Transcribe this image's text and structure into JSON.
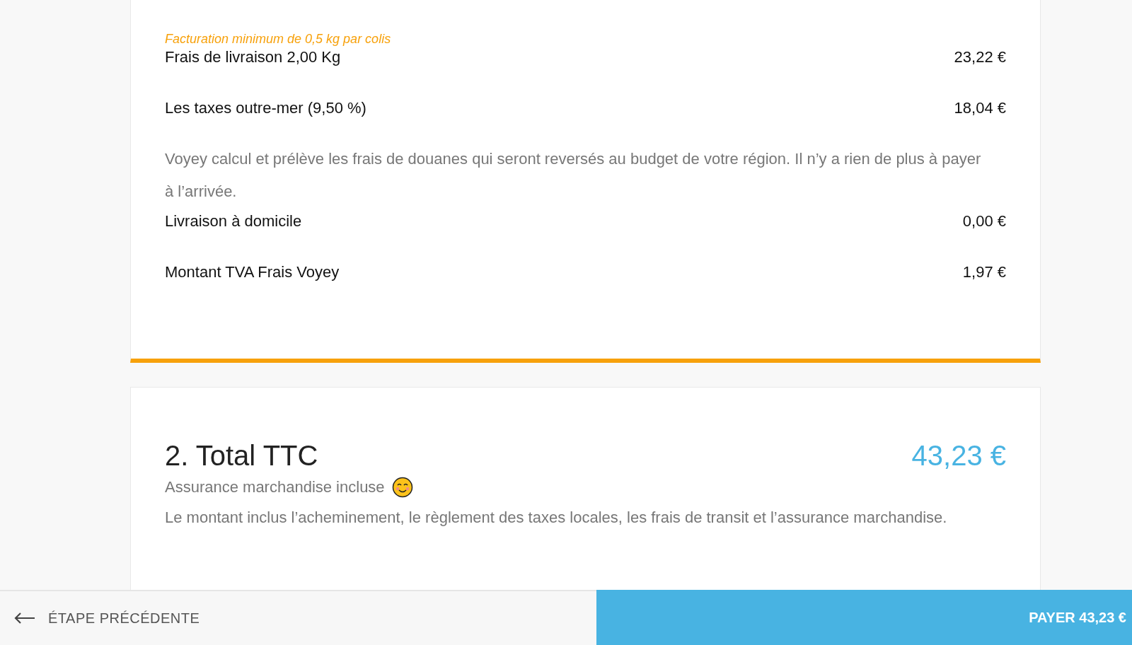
{
  "charges": [
    {
      "note": "Facturation minimum de 0,5 kg par colis",
      "label": "Frais de livraison 2,00 Kg",
      "amount": "23,22 €"
    },
    {
      "label": "Les taxes outre-mer (9,50 %)",
      "amount": "18,04 €",
      "description": "Voyey calcul et prélève les frais de douanes qui seront reversés au budget de votre région. Il n’y a rien de plus à payer à l’arrivée."
    },
    {
      "label": "Livraison à domicile",
      "amount": "0,00 €"
    },
    {
      "label": "Montant TVA Frais Voyey",
      "amount": "1,97 €"
    }
  ],
  "total": {
    "title": "2. Total TTC",
    "amount": "43,23 €",
    "insurance": "Assurance marchandise incluse",
    "description": "Le montant inclus l’acheminement, le règlement des taxes locales, les frais de transit et l’assurance marchandise."
  },
  "footer": {
    "back": "ÉTAPE PRÉCÉDENTE",
    "pay": "PAYER 43,23 €"
  }
}
